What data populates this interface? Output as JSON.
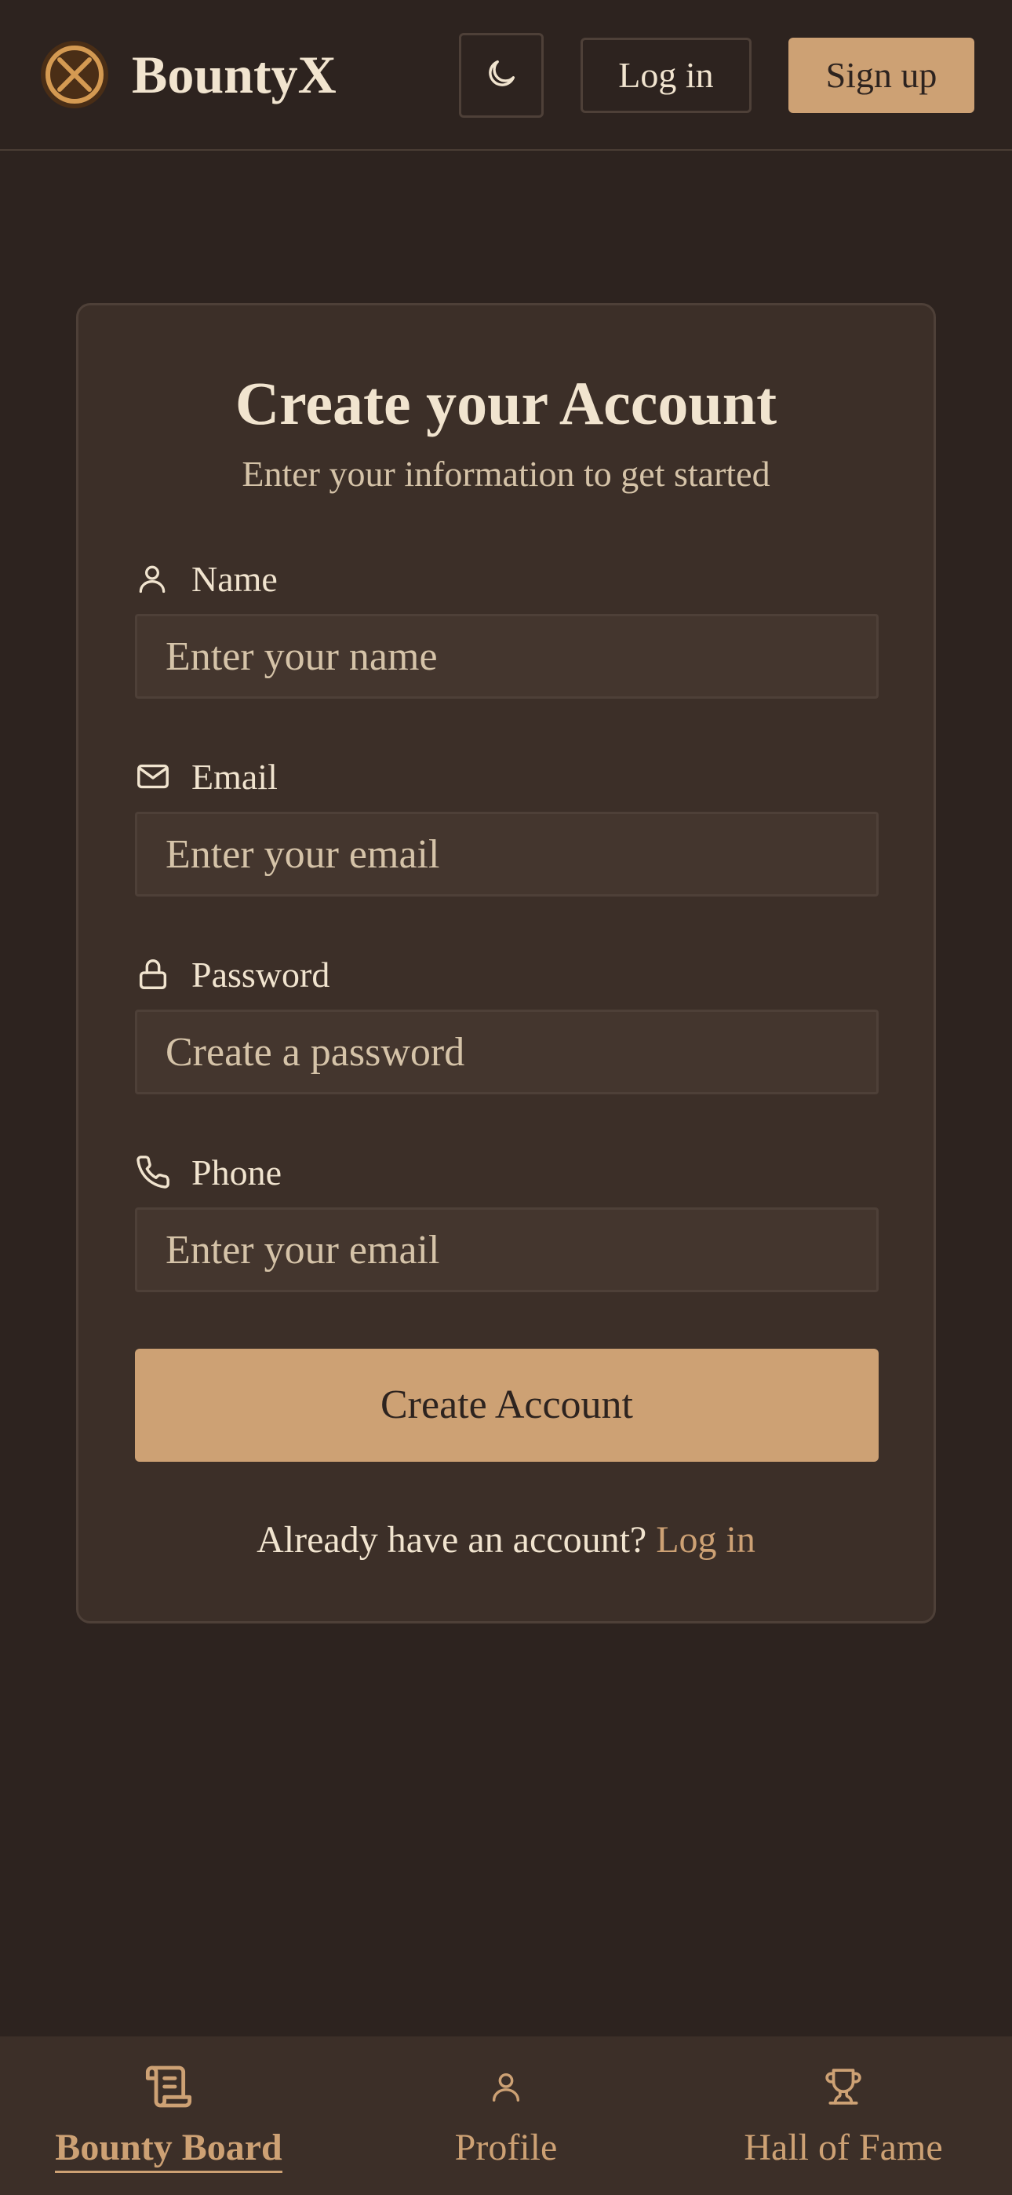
{
  "header": {
    "brand": "BountyX",
    "logo_icon": "compass-cross-icon",
    "theme_icon": "moon-icon",
    "login_label": "Log in",
    "signup_label": "Sign up"
  },
  "form": {
    "title": "Create your Account",
    "subtitle": "Enter your information to get started",
    "fields": [
      {
        "label": "Name",
        "icon": "user-icon",
        "placeholder": "Enter your name",
        "value": ""
      },
      {
        "label": "Email",
        "icon": "mail-icon",
        "placeholder": "Enter your email",
        "value": ""
      },
      {
        "label": "Password",
        "icon": "lock-icon",
        "placeholder": "Create a password",
        "value": ""
      },
      {
        "label": "Phone",
        "icon": "phone-icon",
        "placeholder": "Enter your email",
        "value": ""
      }
    ],
    "submit_label": "Create Account",
    "footer_text": "Already have an account?",
    "footer_link": "Log in"
  },
  "bottom_nav": {
    "items": [
      {
        "label": "Bounty Board",
        "icon": "scroll-icon",
        "active": true
      },
      {
        "label": "Profile",
        "icon": "user-icon",
        "active": false
      },
      {
        "label": "Hall of Fame",
        "icon": "trophy-icon",
        "active": false
      }
    ]
  },
  "colors": {
    "background": "#2d231f",
    "card": "#3c2f28",
    "input": "#44362e",
    "accent": "#cda174",
    "text": "#f1e4cf",
    "muted_text": "#d5c3a8",
    "border": "#4e4038"
  }
}
